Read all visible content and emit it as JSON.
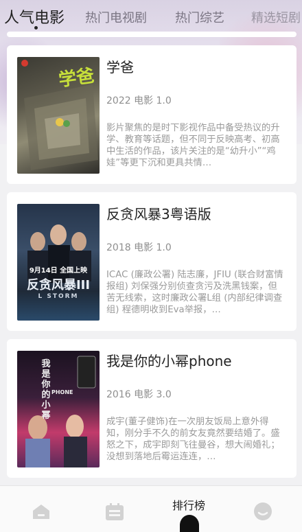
{
  "tabs": [
    {
      "label": "人气电影",
      "active": true
    },
    {
      "label": "热门电视剧"
    },
    {
      "label": "热门综艺"
    },
    {
      "label": "精选短剧"
    }
  ],
  "movies": [
    {
      "title": "学爸",
      "meta": "2022 电影 1.0",
      "desc": "影片聚焦的是时下影视作品中备受热议的升学、教育等话题，但不同于反映高考、初高中生活的作品，该片关注的是“幼升小”“鸡娃”等更下沉和更具共情…",
      "poster_text": "学爸"
    },
    {
      "title": "反贪风暴3粤语版",
      "meta": "2018 电影 1.0",
      "desc": "ICAC (廉政公署) 陆志廉，JFIU (联合财富情报组) 刘保强分别侦查贪污及洗黑钱案，但苦无线索，这时廉政公署L组 (内部纪律调查组) 程德明收到Eva举报，…",
      "poster_text": "反贪风暴III",
      "poster_sub": "L STORM",
      "poster_date": "9月14日 全国上映"
    },
    {
      "title": "我是你的小幂phone",
      "meta": "2016 电影 3.0",
      "desc": "成宇(董子健饰)在一次朋友饭局上意外得知，刚分手不久的前女友竟然要结婚了。盛怒之下，成宇即刻飞往曼谷，想大闹婚礼；没想到落地后霉运连连，…",
      "poster_text": "我是你的小幂",
      "poster_sub": "PHONE"
    }
  ],
  "nav": [
    {
      "label": "",
      "icon": "home-icon"
    },
    {
      "label": "",
      "icon": "calendar-icon"
    },
    {
      "label": "排行榜",
      "icon": "ranking-icon"
    },
    {
      "label": "",
      "icon": "smile-icon"
    }
  ],
  "colors": {
    "accent": "#111111",
    "card": "#ffffff",
    "background": "#f1f1f3"
  }
}
